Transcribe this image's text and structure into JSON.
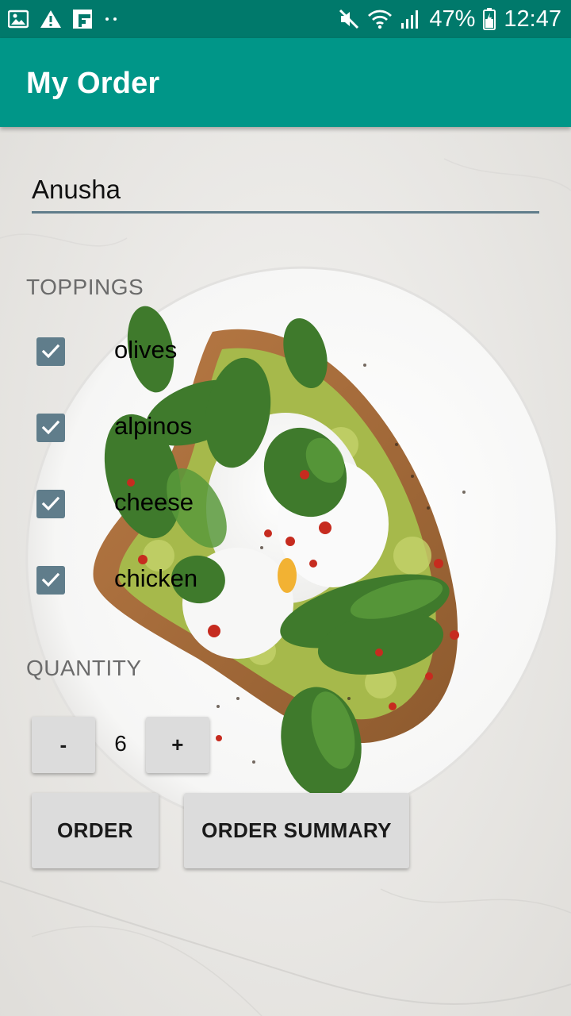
{
  "status_bar": {
    "battery_percent": "47%",
    "time": "12:47",
    "icons": [
      "image-icon",
      "warning-icon",
      "flipboard-icon",
      "more-dots-icon",
      "mute-icon",
      "wifi-icon",
      "signal-icon",
      "battery-icon"
    ]
  },
  "app_bar": {
    "title": "My Order",
    "color": "#009688",
    "status_color": "#00796b"
  },
  "form": {
    "name_value": "Anusha",
    "toppings_label": "TOPPINGS",
    "toppings": [
      {
        "label": "olives",
        "checked": true
      },
      {
        "label": "alpinos",
        "checked": true
      },
      {
        "label": "cheese",
        "checked": true
      },
      {
        "label": "chicken",
        "checked": true
      }
    ],
    "quantity_label": "QUANTITY",
    "quantity_value": "6",
    "decrement_label": "-",
    "increment_label": "+",
    "order_button": "ORDER",
    "summary_button": "ORDER SUMMARY",
    "accent_color": "#607d8b"
  },
  "background": {
    "description_icon": "food-plate-background"
  }
}
